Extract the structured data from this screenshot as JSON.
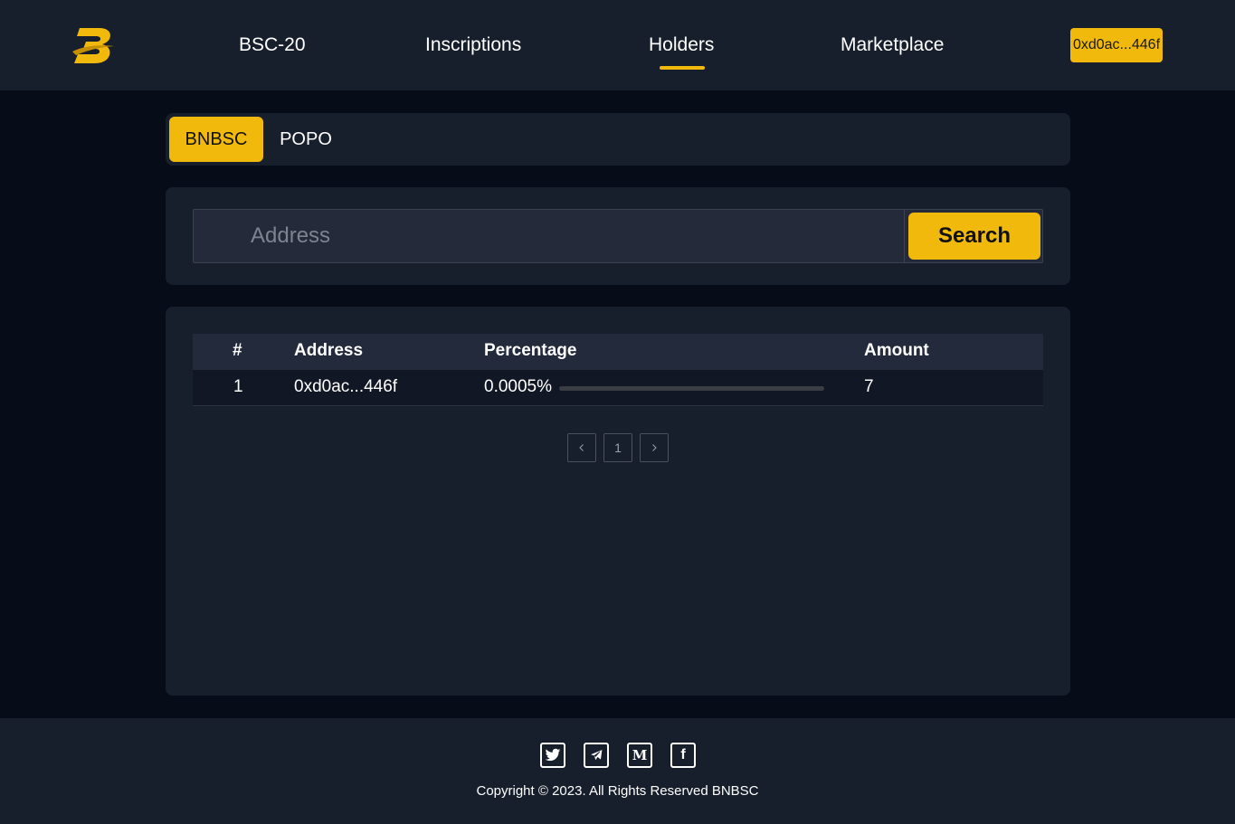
{
  "colors": {
    "accent": "#f0b90b",
    "header_bg": "#181f2c",
    "page_bg": "#070d18"
  },
  "header": {
    "logo_icon": "bnbsc-logo-icon",
    "nav": [
      {
        "label": "BSC-20",
        "active": false
      },
      {
        "label": "Inscriptions",
        "active": false
      },
      {
        "label": "Holders",
        "active": true
      },
      {
        "label": "Marketplace",
        "active": false
      }
    ],
    "wallet_label": "0xd0ac...446f"
  },
  "tabs": [
    {
      "label": "BNBSC",
      "active": true
    },
    {
      "label": "POPO",
      "active": false
    }
  ],
  "search": {
    "placeholder": "Address",
    "value": "",
    "button_label": "Search"
  },
  "table": {
    "columns": [
      "#",
      "Address",
      "Percentage",
      "Amount"
    ],
    "rows": [
      {
        "rank": "1",
        "address": "0xd0ac...446f",
        "percentage": "0.0005%",
        "percentage_fraction": 5e-06,
        "amount": "7"
      }
    ]
  },
  "pagination": {
    "prev_icon": "chevron-left-icon",
    "current_page": "1",
    "next_icon": "chevron-right-icon"
  },
  "footer": {
    "social_icons": [
      "twitter-icon",
      "telegram-icon",
      "medium-icon",
      "facebook-icon"
    ],
    "copyright": "Copyright © 2023. All Rights Reserved BNBSC"
  }
}
